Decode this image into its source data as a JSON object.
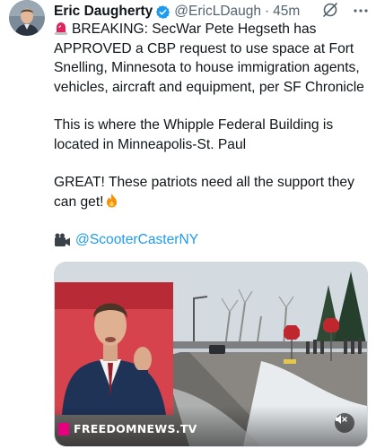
{
  "author": {
    "name": "Eric Daugherty",
    "handle": "@EricLDaugh",
    "separator": "·",
    "time": "45m",
    "verified": true,
    "avatar_icon": "profile-photo"
  },
  "tweet": {
    "line1": "BREAKING: SecWar Pete Hegseth has APPROVED a CBP request to use space at Fort Snelling, Minnesota to house immigration agents, vehicles, aircraft and equipment, per SF Chronicle",
    "line2": "This is where the Whipple Federal Building is located in Minneapolis-St. Paul",
    "line3": "GREAT! These patriots need all the support they can get!",
    "mention": "@ScooterCasterNY",
    "icons": [
      "siren-icon",
      "fire-icon",
      "camera-icon"
    ]
  },
  "media": {
    "watermark": "FREEDOMNEWS.TV",
    "mute_icon": "speaker-muted-icon",
    "accent": "#e6007e"
  },
  "colors": {
    "link": "#1d9bf0",
    "verified": "#1d9bf0",
    "secondary_text": "#536471"
  }
}
